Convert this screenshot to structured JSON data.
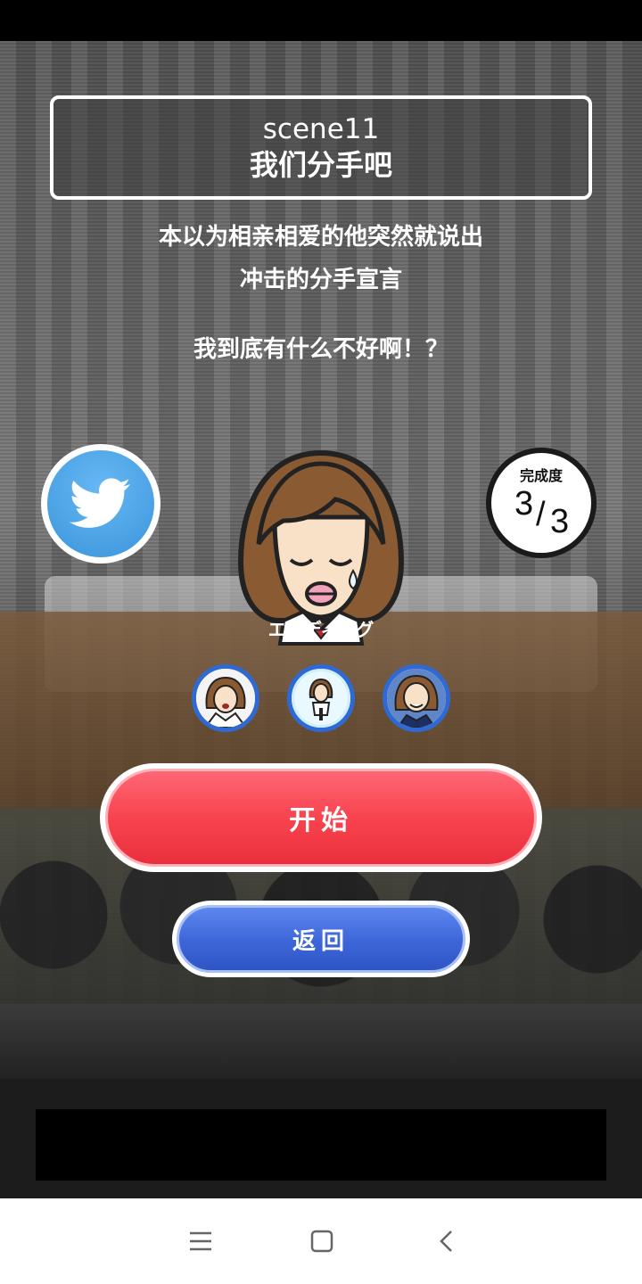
{
  "scene": {
    "label": "scene11",
    "title": "我们分手吧"
  },
  "description": {
    "line1": "本以为相亲相爱的他突然就说出",
    "line2": "冲击的分手宣言",
    "line3": "我到底有什么不好啊！？"
  },
  "completion": {
    "label": "完成度",
    "current": "3",
    "slash": "/",
    "total": "3"
  },
  "character": {
    "caption": "エンディング"
  },
  "endings": [
    {
      "icon": "ending-1-icon"
    },
    {
      "icon": "ending-2-icon"
    },
    {
      "icon": "ending-3-icon"
    }
  ],
  "buttons": {
    "start": "开始",
    "back": "返回"
  },
  "icons": {
    "share": "twitter-icon",
    "nav": [
      "menu-icon",
      "home-icon",
      "back-icon"
    ]
  },
  "colors": {
    "start_button": "#f8444f",
    "back_button": "#3c66d8",
    "twitter_blue": "#3a95dc"
  }
}
